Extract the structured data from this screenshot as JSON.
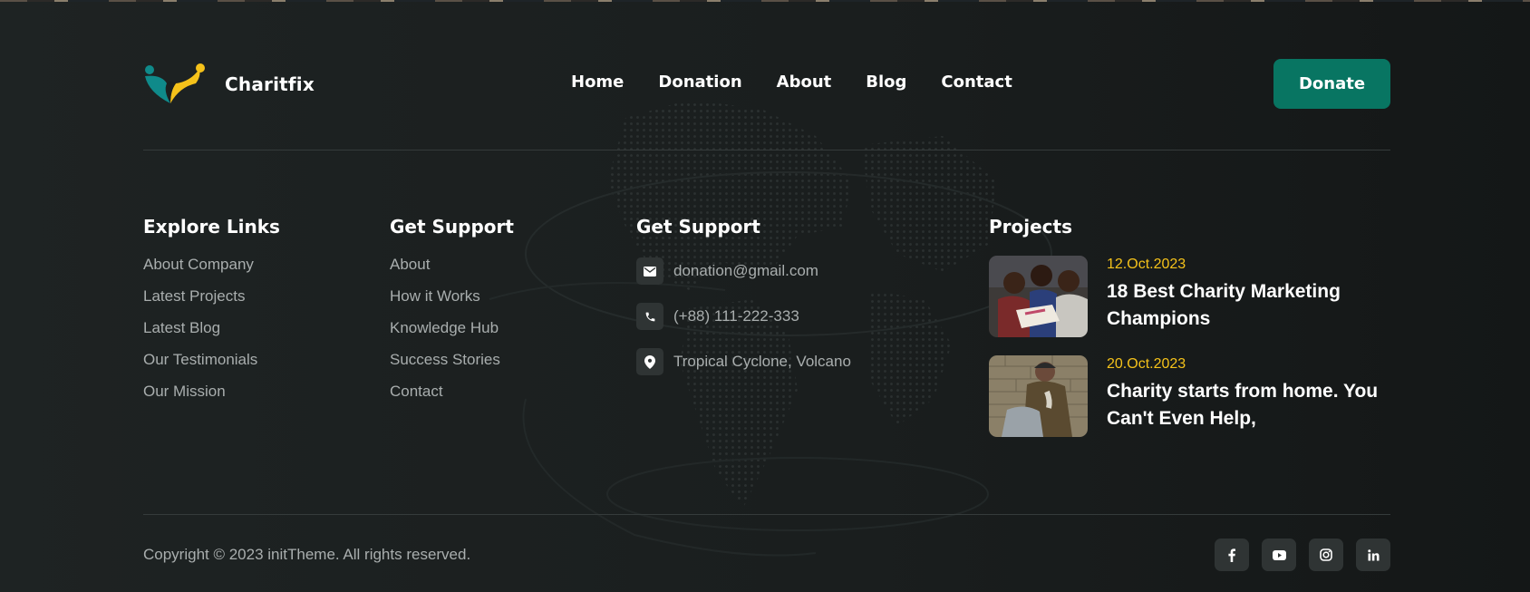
{
  "brand": {
    "name": "Charitfix",
    "logo_colors": {
      "teal": "#0f8a8a",
      "yellow": "#f5c21a"
    }
  },
  "nav": {
    "items": [
      {
        "label": "Home"
      },
      {
        "label": "Donation"
      },
      {
        "label": "About"
      },
      {
        "label": "Blog"
      },
      {
        "label": "Contact"
      }
    ]
  },
  "header": {
    "donate_label": "Donate"
  },
  "explore": {
    "title": "Explore Links",
    "links": [
      "About Company",
      "Latest Projects",
      "Latest Blog",
      "Our Testimonials",
      "Our Mission"
    ]
  },
  "support": {
    "title": "Get Support",
    "links": [
      "About",
      "How it Works",
      "Knowledge Hub",
      "Success Stories",
      "Contact"
    ]
  },
  "contact": {
    "title": "Get Support",
    "email": {
      "icon": "mail-icon",
      "text": "donation@gmail.com"
    },
    "phone": {
      "icon": "phone-icon",
      "text": "(+88) 111-222-333"
    },
    "location": {
      "icon": "location-pin-icon",
      "text": "Tropical Cyclone, Volcano"
    }
  },
  "projects": {
    "title": "Projects",
    "items": [
      {
        "date": "12.Oct.2023",
        "title": "18 Best Charity Marketing Champions",
        "image": "children-reading-photo"
      },
      {
        "date": "20.Oct.2023",
        "title": "Charity starts from home. You Can't Even Help,",
        "image": "elderly-man-photo"
      }
    ]
  },
  "footer": {
    "copyright": "Copyright © 2023 initTheme. All rights reserved.",
    "socials": [
      {
        "icon": "facebook-icon"
      },
      {
        "icon": "youtube-icon"
      },
      {
        "icon": "instagram-icon"
      },
      {
        "icon": "linkedin-icon"
      }
    ]
  },
  "colors": {
    "background": "#1b1f1f",
    "accent": "#087562",
    "date": "#f5c21a",
    "muted_text": "#a9aeae",
    "icon_bg": "#2f3434"
  }
}
